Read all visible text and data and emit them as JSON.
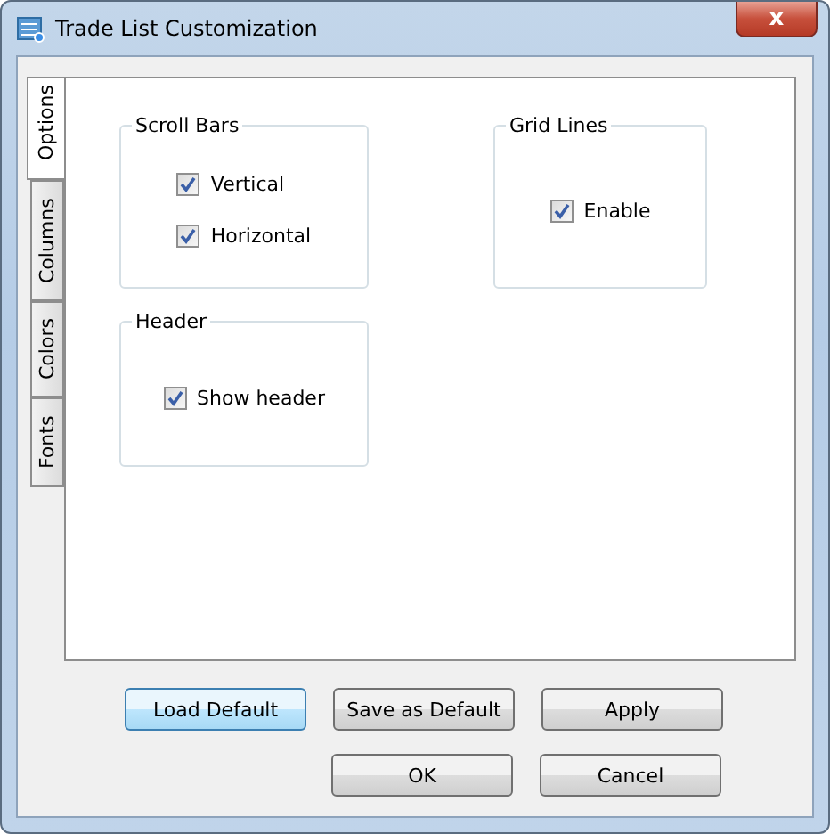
{
  "window": {
    "title": "Trade List Customization",
    "close": "x"
  },
  "tabs": [
    {
      "label": "Options",
      "selected": true
    },
    {
      "label": "Columns",
      "selected": false
    },
    {
      "label": "Colors",
      "selected": false
    },
    {
      "label": "Fonts",
      "selected": false
    }
  ],
  "groups": [
    {
      "title": "Scroll Bars",
      "options": [
        {
          "label": "Vertical",
          "checked": true
        },
        {
          "label": "Horizontal",
          "checked": true
        }
      ]
    },
    {
      "title": "Grid Lines",
      "options": [
        {
          "label": "Enable",
          "checked": true
        }
      ]
    },
    {
      "title": "Header",
      "options": [
        {
          "label": "Show header",
          "checked": true
        }
      ]
    }
  ],
  "button_rows": [
    [
      {
        "label": "Load Default",
        "focused": true
      },
      {
        "label": "Save as Default",
        "focused": false
      },
      {
        "label": "Apply",
        "focused": false
      }
    ],
    [
      {
        "label": "OK",
        "focused": false
      },
      {
        "label": "Cancel",
        "focused": false
      }
    ]
  ]
}
